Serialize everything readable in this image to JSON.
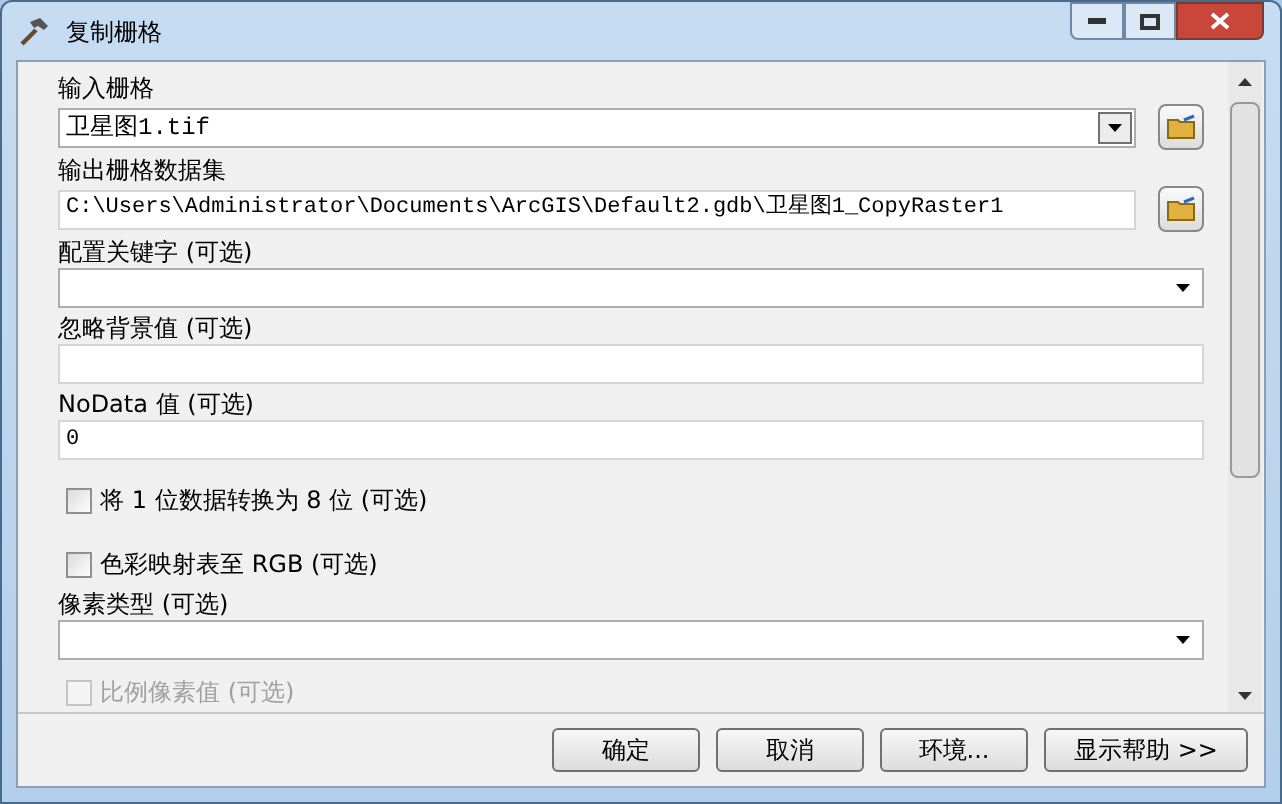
{
  "window": {
    "title": "复制栅格"
  },
  "params": [
    {
      "kind": "combo",
      "label": "输入栅格",
      "value": "卫星图1.tif",
      "browse": true
    },
    {
      "kind": "field",
      "label": "输出栅格数据集",
      "value": "C:\\Users\\Administrator\\Documents\\ArcGIS\\Default2.gdb\\卫星图1_CopyRaster1",
      "browse": true
    },
    {
      "kind": "combo",
      "label": "配置关键字 (可选)"
    },
    {
      "kind": "field",
      "label": "忽略背景值 (可选)"
    },
    {
      "kind": "field",
      "label": "NoData 值 (可选)",
      "value": "0"
    },
    {
      "kind": "checkbox",
      "label": "将 1 位数据转换为 8 位 (可选)",
      "checked": false,
      "disabled": false
    },
    {
      "kind": "checkbox",
      "label": "色彩映射表至 RGB (可选)",
      "checked": false,
      "disabled": false
    },
    {
      "kind": "combo",
      "label": "像素类型 (可选)"
    },
    {
      "kind": "checkbox",
      "label": "比例像素值 (可选)",
      "checked": false,
      "disabled": true
    }
  ],
  "buttons": [
    "确定",
    "取消",
    "环境...",
    "显示帮助 >>"
  ]
}
